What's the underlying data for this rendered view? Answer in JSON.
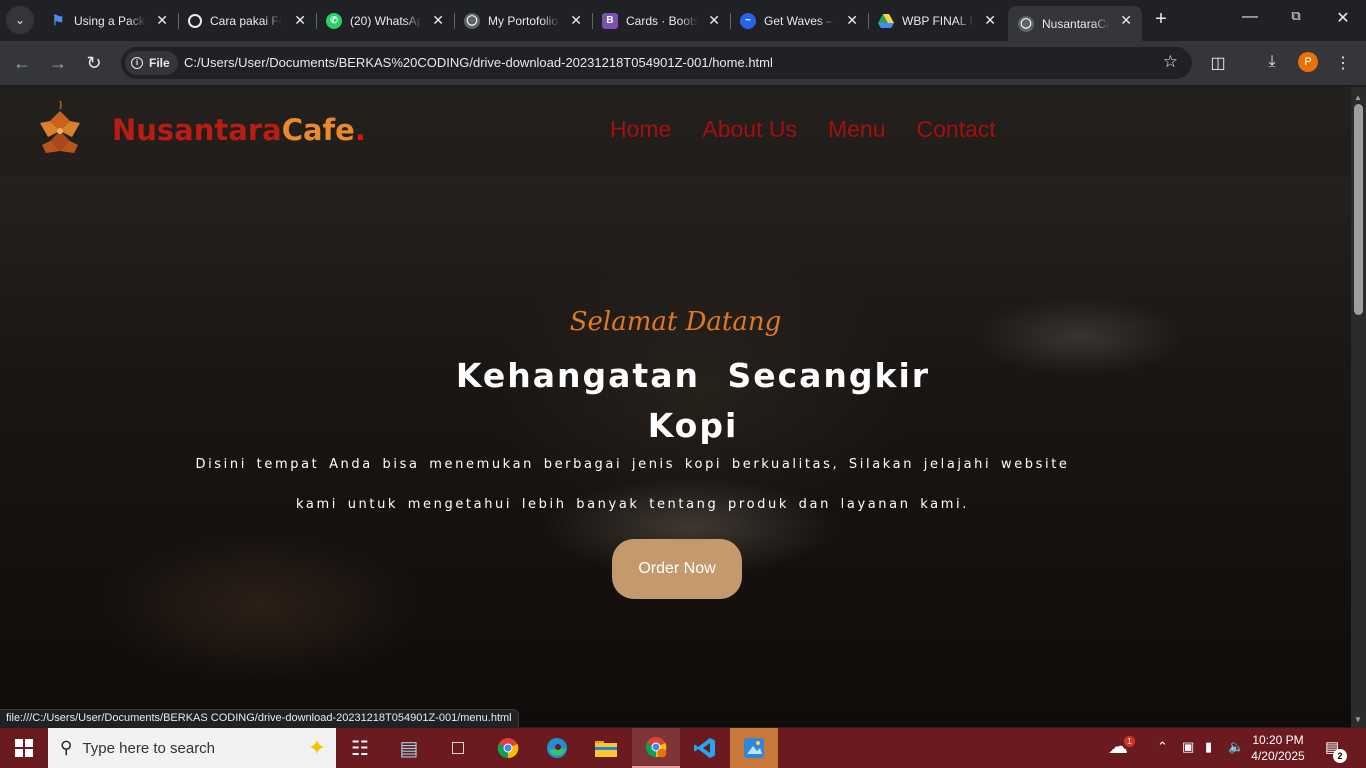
{
  "browser": {
    "tab_menu_icon": "chevron-down-icon",
    "tabs": [
      {
        "title": "Using a Pack",
        "favicon": "flag-icon",
        "color": "#4b8bf5"
      },
      {
        "title": "Cara pakai Fo",
        "favicon": "openai-icon",
        "color": "#e8eaed"
      },
      {
        "title": "(20) WhatsAp",
        "favicon": "whatsapp-icon",
        "color": "#25d366"
      },
      {
        "title": "My Portofolio",
        "favicon": "globe-icon",
        "color": "#e8eaed"
      },
      {
        "title": "Cards · Boots",
        "favicon": "bootstrap-icon",
        "color": "#7952b3"
      },
      {
        "title": "Get Waves –",
        "favicon": "waves-icon",
        "color": "#2563eb"
      },
      {
        "title": "WBP FINAL P",
        "favicon": "google-drive-icon",
        "color": "#fbbc04"
      },
      {
        "title": "NusantaraCaf",
        "favicon": "globe-icon",
        "color": "#e8eaed",
        "active": true
      }
    ],
    "new_tab_label": "+",
    "address": {
      "chip_label": "File",
      "url": "C:/Users/User/Documents/BERKAS%20CODING/drive-download-20231218T054901Z-001/home.html"
    },
    "profile_initial": "P",
    "status_url": "file:///C:/Users/User/Documents/BERKAS CODING/drive-download-20231218T054901Z-001/menu.html"
  },
  "site": {
    "brand": {
      "part1": "Nusantara",
      "part2": "Cafe",
      "part3": "."
    },
    "nav": [
      "Home",
      "About Us",
      "Menu",
      "Contact"
    ],
    "hero": {
      "greeting": "Selamat Datang",
      "headline_line1": "Kehangatan Secangkir",
      "headline_line2": "Kopi",
      "description": "Disini tempat Anda bisa menemukan berbagai jenis kopi berkualitas, Silakan jelajahi website kami untuk mengetahui lebih banyak tentang produk dan layanan kami.",
      "cta": "Order Now"
    },
    "colors": {
      "brand_red": "#b81c12",
      "brand_orange": "#e98a2d",
      "cta_bg": "#c49a6c",
      "greeting": "#dd7a24"
    }
  },
  "taskbar": {
    "search_placeholder": "Type here to search",
    "apps": [
      "task-view-icon",
      "notes-icon",
      "file-icon",
      "chrome-icon",
      "edge-icon",
      "file-explorer-icon",
      "chrome-profile-icon",
      "vscode-icon",
      "paint-icon"
    ],
    "weather_badge": "1",
    "time": "10:20 PM",
    "date": "4/20/2025",
    "notification_count": "2"
  }
}
